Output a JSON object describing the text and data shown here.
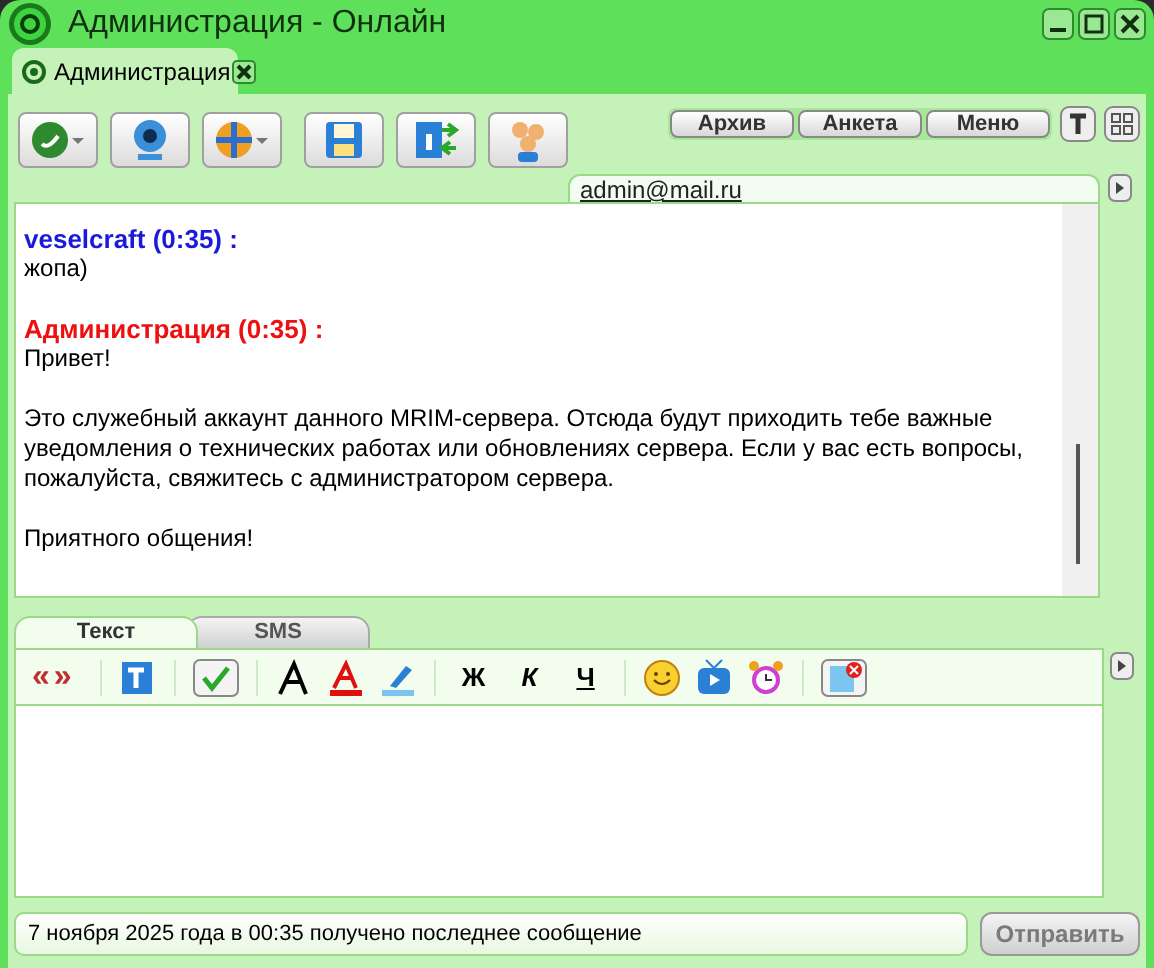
{
  "window": {
    "title": "Администрация - Онлайн"
  },
  "tabs": [
    {
      "label": "Администрация",
      "selected": true
    }
  ],
  "top_buttons": [
    "Архив",
    "Анкета",
    "Меню"
  ],
  "contact": {
    "email": "admin@mail.ru"
  },
  "messages": [
    {
      "kind": "contact",
      "header": "veselcraft (0:35) :",
      "paragraphs": [
        "жопа)"
      ]
    },
    {
      "kind": "self",
      "header": "Администрация (0:35) :",
      "paragraphs": [
        "Привет!",
        "Это служебный аккаунт данного MRIM-сервера. Отсюда будут приходить тебе важные уведомления о технических работах или обновлениях сервера. Если у вас есть вопросы, пожалуйста, свяжитесь с администратором сервера.",
        "Приятного общения!"
      ]
    }
  ],
  "input_tabs": [
    {
      "label": "Текст",
      "selected": true
    },
    {
      "label": "SMS",
      "selected": false
    }
  ],
  "format": {
    "quotes": "«»",
    "bold": "Ж",
    "italic": "К",
    "underline": "Ч"
  },
  "status_bar": {
    "text": "7 ноября 2025 года в 00:35 получено последнее сообщение"
  },
  "send_button": {
    "label": "Отправить",
    "disabled": true
  }
}
